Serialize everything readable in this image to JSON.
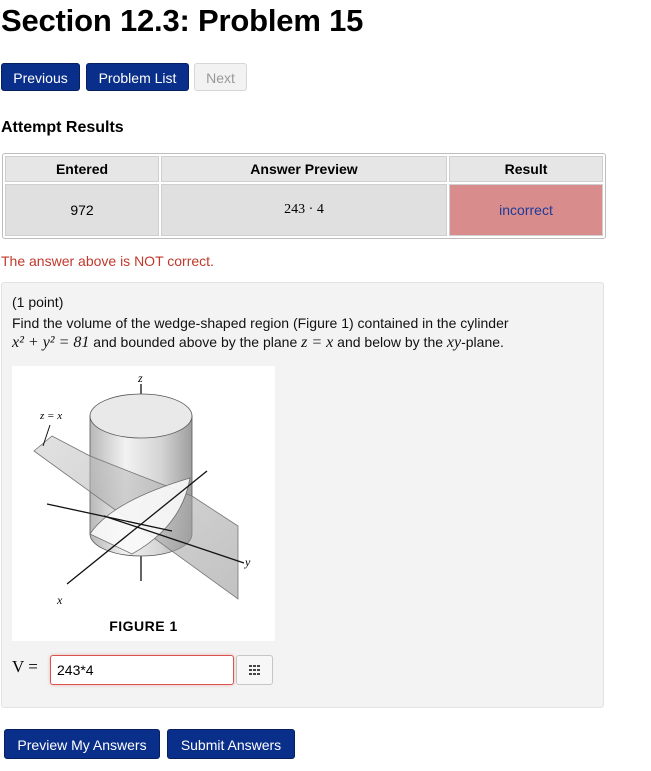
{
  "page": {
    "title": "Section 12.3: Problem 15"
  },
  "nav": {
    "previous_label": "Previous",
    "problem_list_label": "Problem List",
    "next_label": "Next"
  },
  "attempt": {
    "heading": "Attempt Results",
    "columns": [
      "Entered",
      "Answer Preview",
      "Result"
    ],
    "row": {
      "entered": "972",
      "preview": "243 · 4",
      "result": "incorrect"
    },
    "message": "The answer above is NOT correct."
  },
  "problem": {
    "points": "(1 point)",
    "text_line1": "Find the volume of the wedge-shaped region (Figure 1) contained in the cylinder",
    "eq_cylinder": "x² + y² = 81",
    "text_and_bounded": " and bounded above by the plane ",
    "eq_plane": "z = x",
    "text_below": " and below by the ",
    "eq_xy": "xy",
    "text_plane_end": "-plane.",
    "figure": {
      "label_z": "z",
      "label_y": "y",
      "label_x": "x",
      "label_plane": "z = x",
      "caption": "FIGURE 1"
    },
    "answer": {
      "label": "V =",
      "value": "243*4"
    }
  },
  "actions": {
    "preview_label": "Preview My Answers",
    "submit_label": "Submit Answers"
  },
  "colors": {
    "button_primary": "#0a2f8a",
    "incorrect_cell": "#d98c8c",
    "error_text": "#c0392b"
  }
}
